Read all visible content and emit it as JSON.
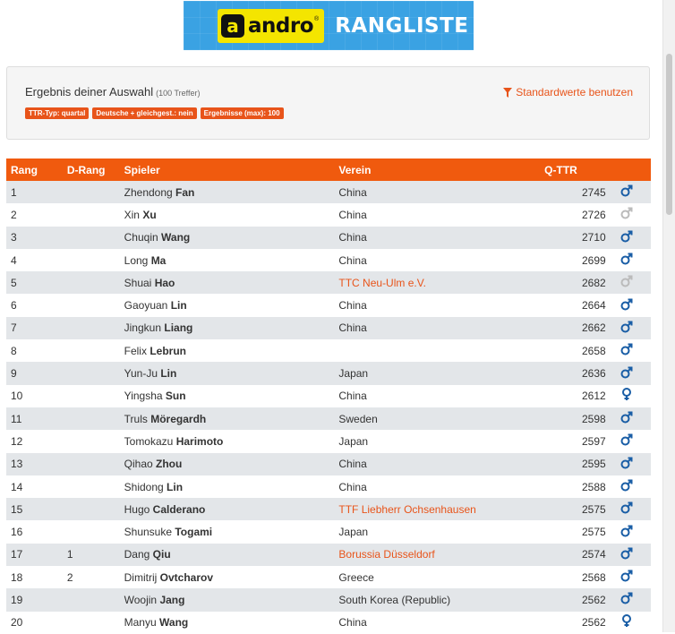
{
  "banner": {
    "logo_mark": "a",
    "logo_text": "andro",
    "logo_reg": "®",
    "title": "RANGLISTE"
  },
  "result_panel": {
    "title": "Ergebnis deiner Auswahl",
    "count": "(100 Treffer)",
    "reset_link": "Standardwerte benutzen",
    "badges": [
      "TTR-Typ: quartal",
      "Deutsche + gleichgest.: nein",
      "Ergebnisse (max): 100"
    ]
  },
  "table": {
    "headers": {
      "rang": "Rang",
      "drang": "D-Rang",
      "spieler": "Spieler",
      "verein": "Verein",
      "ttr": "Q-TTR"
    },
    "rows": [
      {
        "rang": "1",
        "drang": "",
        "first": "Zhendong",
        "last": "Fan",
        "club": "China",
        "club_link": false,
        "ttr": "2745",
        "gender": "male",
        "active": true
      },
      {
        "rang": "2",
        "drang": "",
        "first": "Xin",
        "last": "Xu",
        "club": "China",
        "club_link": false,
        "ttr": "2726",
        "gender": "male",
        "active": false
      },
      {
        "rang": "3",
        "drang": "",
        "first": "Chuqin",
        "last": "Wang",
        "club": "China",
        "club_link": false,
        "ttr": "2710",
        "gender": "male",
        "active": true
      },
      {
        "rang": "4",
        "drang": "",
        "first": "Long",
        "last": "Ma",
        "club": "China",
        "club_link": false,
        "ttr": "2699",
        "gender": "male",
        "active": true
      },
      {
        "rang": "5",
        "drang": "",
        "first": "Shuai",
        "last": "Hao",
        "club": "TTC Neu-Ulm e.V.",
        "club_link": true,
        "ttr": "2682",
        "gender": "male",
        "active": false
      },
      {
        "rang": "6",
        "drang": "",
        "first": "Gaoyuan",
        "last": "Lin",
        "club": "China",
        "club_link": false,
        "ttr": "2664",
        "gender": "male",
        "active": true
      },
      {
        "rang": "7",
        "drang": "",
        "first": "Jingkun",
        "last": "Liang",
        "club": "China",
        "club_link": false,
        "ttr": "2662",
        "gender": "male",
        "active": true
      },
      {
        "rang": "8",
        "drang": "",
        "first": "Felix",
        "last": "Lebrun",
        "club": "",
        "club_link": false,
        "ttr": "2658",
        "gender": "male",
        "active": true
      },
      {
        "rang": "9",
        "drang": "",
        "first": "Yun-Ju",
        "last": "Lin",
        "club": "Japan",
        "club_link": false,
        "ttr": "2636",
        "gender": "male",
        "active": true
      },
      {
        "rang": "10",
        "drang": "",
        "first": "Yingsha",
        "last": "Sun",
        "club": "China",
        "club_link": false,
        "ttr": "2612",
        "gender": "female",
        "active": true
      },
      {
        "rang": "11",
        "drang": "",
        "first": "Truls",
        "last": "Möregardh",
        "club": "Sweden",
        "club_link": false,
        "ttr": "2598",
        "gender": "male",
        "active": true
      },
      {
        "rang": "12",
        "drang": "",
        "first": "Tomokazu",
        "last": "Harimoto",
        "club": "Japan",
        "club_link": false,
        "ttr": "2597",
        "gender": "male",
        "active": true
      },
      {
        "rang": "13",
        "drang": "",
        "first": "Qihao",
        "last": "Zhou",
        "club": "China",
        "club_link": false,
        "ttr": "2595",
        "gender": "male",
        "active": true
      },
      {
        "rang": "14",
        "drang": "",
        "first": "Shidong",
        "last": "Lin",
        "club": "China",
        "club_link": false,
        "ttr": "2588",
        "gender": "male",
        "active": true
      },
      {
        "rang": "15",
        "drang": "",
        "first": "Hugo",
        "last": "Calderano",
        "club": "TTF Liebherr Ochsenhausen",
        "club_link": true,
        "ttr": "2575",
        "gender": "male",
        "active": true
      },
      {
        "rang": "16",
        "drang": "",
        "first": "Shunsuke",
        "last": "Togami",
        "club": "Japan",
        "club_link": false,
        "ttr": "2575",
        "gender": "male",
        "active": true
      },
      {
        "rang": "17",
        "drang": "1",
        "first": "Dang",
        "last": "Qiu",
        "club": "Borussia Düsseldorf",
        "club_link": true,
        "ttr": "2574",
        "gender": "male",
        "active": true
      },
      {
        "rang": "18",
        "drang": "2",
        "first": "Dimitrij",
        "last": "Ovtcharov",
        "club": "Greece",
        "club_link": false,
        "ttr": "2568",
        "gender": "male",
        "active": true
      },
      {
        "rang": "19",
        "drang": "",
        "first": "Woojin",
        "last": "Jang",
        "club": "South Korea (Republic)",
        "club_link": false,
        "ttr": "2562",
        "gender": "male",
        "active": true
      },
      {
        "rang": "20",
        "drang": "",
        "first": "Manyu",
        "last": "Wang",
        "club": "China",
        "club_link": false,
        "ttr": "2562",
        "gender": "female",
        "active": true
      }
    ]
  },
  "colors": {
    "accent": "#f05a0e",
    "link": "#e8541a",
    "icon_active": "#1a5ea6",
    "icon_inactive": "#bbbbbb",
    "row_alt": "#e3e6e9"
  },
  "icons": {
    "male": "male-symbol-icon",
    "female": "female-symbol-icon",
    "filter": "filter-icon"
  }
}
